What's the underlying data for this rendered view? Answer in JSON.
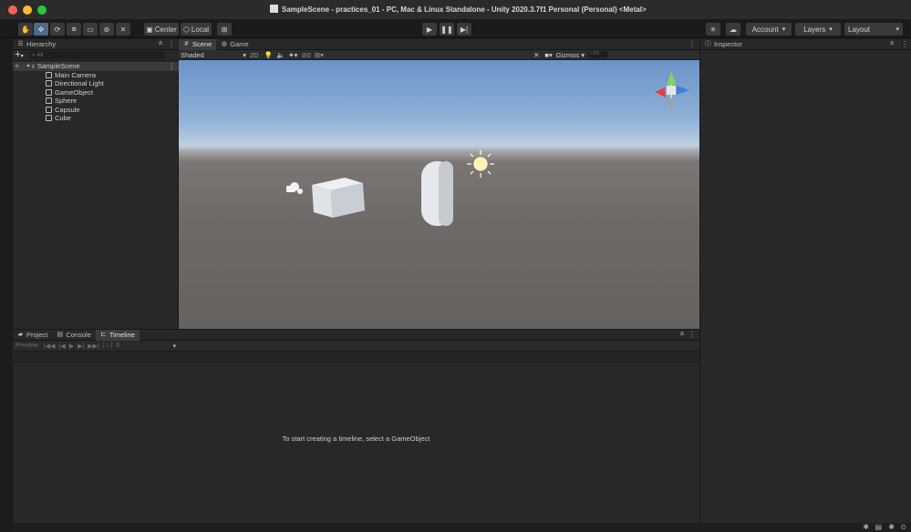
{
  "window": {
    "title": "SampleScene - practices_01 - PC, Mac & Linux Standalone - Unity 2020.3.7f1 Personal (Personal) <Metal>",
    "traffic_colors": [
      "#fe5f57",
      "#febc2e",
      "#28c840"
    ]
  },
  "toolbar": {
    "tools": [
      "hand-icon",
      "move-icon",
      "rotate-icon",
      "scale-icon",
      "rect-icon",
      "transform-icon",
      "custom-tool-icon"
    ],
    "pivot_label": "Center",
    "space_label": "Local",
    "account_label": "Account",
    "layers_label": "Layers",
    "layout_label": "Layout"
  },
  "hierarchy": {
    "tab_label": "Hierarchy",
    "search_placeholder": "All",
    "scene_name": "SampleScene",
    "items": [
      "Main Camera",
      "Directional Light",
      "GameObject",
      "Sphere",
      "Capsule",
      "Cube"
    ]
  },
  "scene": {
    "tabs": [
      "Scene",
      "Game"
    ],
    "shading_mode": "Shaded",
    "mode_2d": "2D",
    "hidden_count": "0",
    "gizmos_label": "Gizmos",
    "search_placeholder": "All"
  },
  "bottom": {
    "tabs": [
      "Project",
      "Console",
      "Timeline"
    ],
    "preview_label": "Preview",
    "frame_value": "0",
    "message": "To start creating a timeline, select a GameObject"
  },
  "inspector": {
    "tab_label": "Inspector"
  },
  "colors": {
    "accent": "#4d6a8a",
    "sky": "#7fa4d2",
    "ground": "#6e6a68"
  }
}
